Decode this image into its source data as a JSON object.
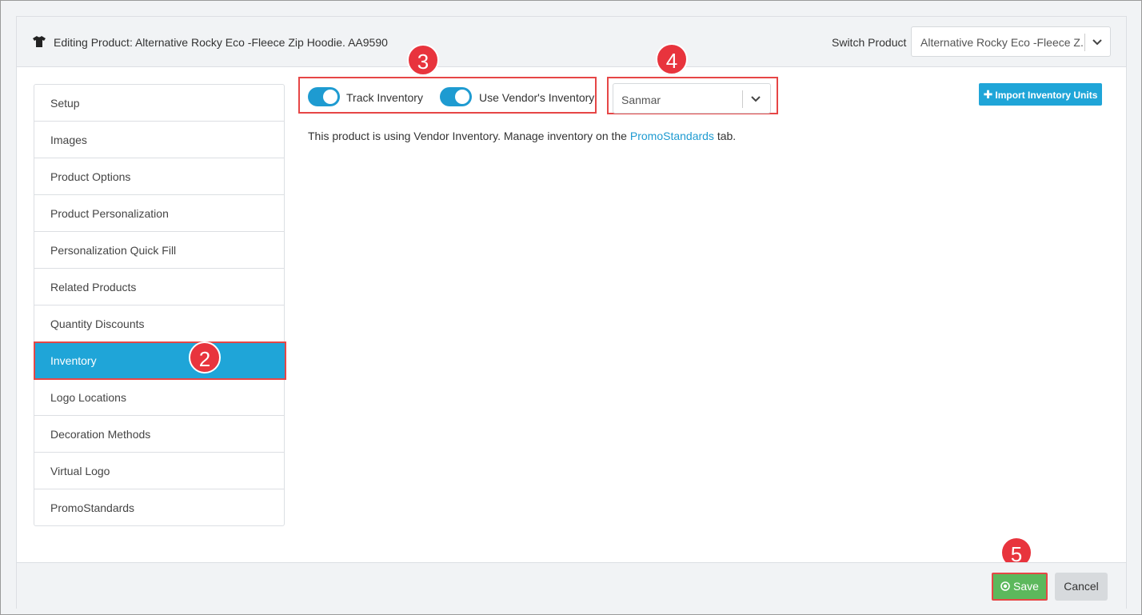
{
  "header": {
    "title": "Editing Product: Alternative Rocky Eco -Fleece Zip Hoodie. AA9590",
    "switch_label": "Switch Product",
    "switch_value": "Alternative Rocky Eco -Fleece Z..."
  },
  "sidebar": {
    "items": [
      {
        "label": "Setup"
      },
      {
        "label": "Images"
      },
      {
        "label": "Product Options"
      },
      {
        "label": "Product Personalization"
      },
      {
        "label": "Personalization Quick Fill"
      },
      {
        "label": "Related Products"
      },
      {
        "label": "Quantity Discounts"
      },
      {
        "label": "Inventory",
        "active": true
      },
      {
        "label": "Logo Locations"
      },
      {
        "label": "Decoration Methods"
      },
      {
        "label": "Virtual Logo"
      },
      {
        "label": "PromoStandards"
      }
    ]
  },
  "inventory": {
    "track_label": "Track Inventory",
    "track_on": true,
    "vendor_label": "Use Vendor's Inventory",
    "vendor_on": true,
    "vendor_value": "Sanmar",
    "import_label": "Import Inventory Units",
    "info_prefix": "This product is using Vendor Inventory. Manage inventory on the ",
    "info_link": "PromoStandards",
    "info_suffix": " tab."
  },
  "callouts": {
    "c2": "2",
    "c3": "3",
    "c4": "4",
    "c5": "5"
  },
  "footer": {
    "save_label": "Save",
    "cancel_label": "Cancel"
  },
  "colors": {
    "accent": "#1fa5d8",
    "toggle": "#1e9bd1",
    "save": "#5cb85c",
    "callout": "#e8343d",
    "highlight": "#e64646"
  }
}
